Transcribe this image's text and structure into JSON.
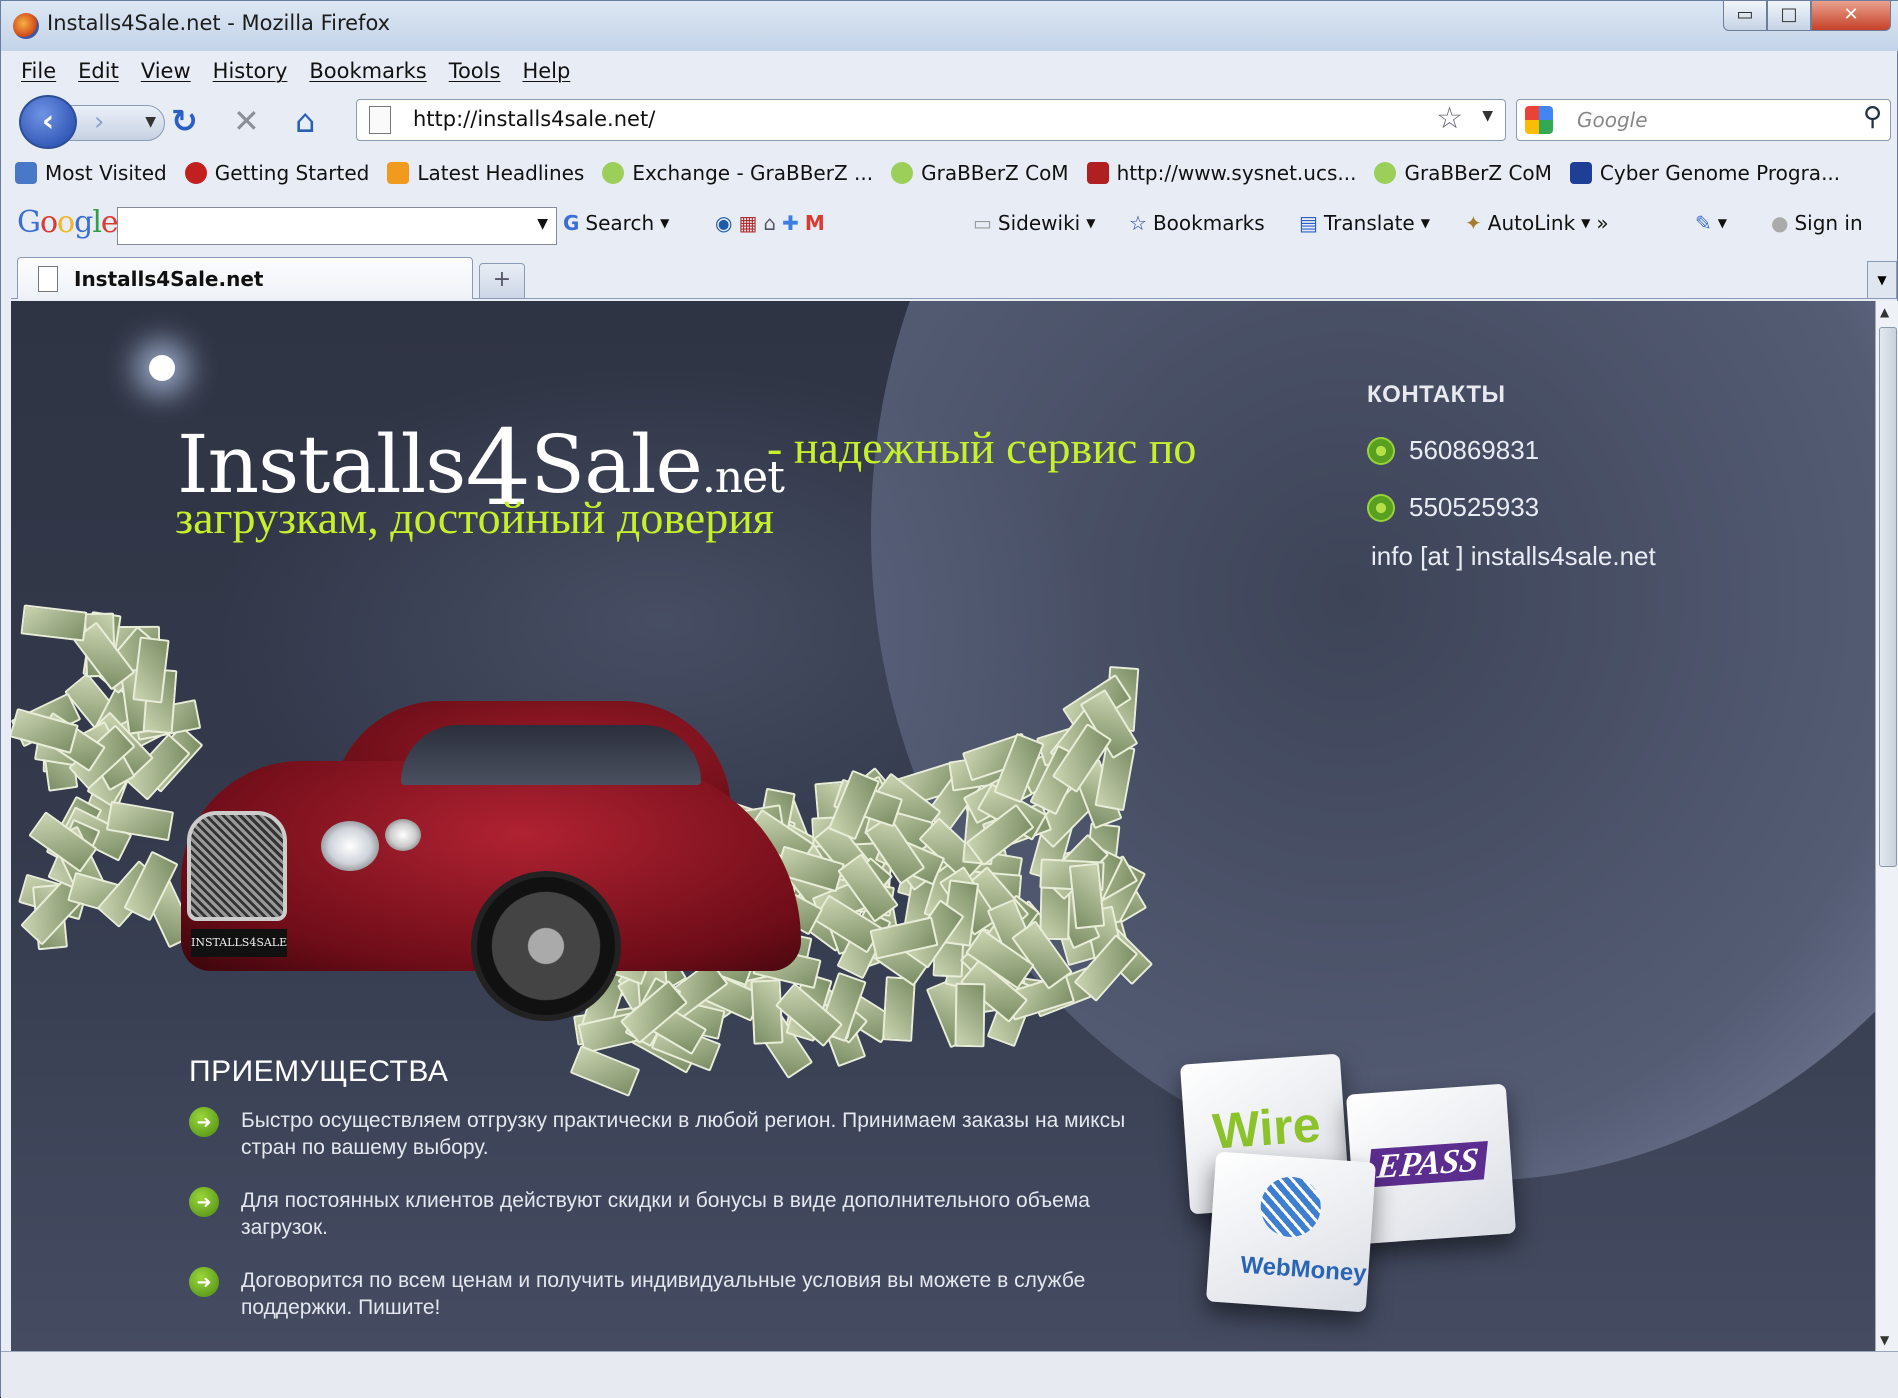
{
  "window": {
    "title": "Installs4Sale.net - Mozilla Firefox",
    "min_glyph": "▭",
    "max_glyph": "□",
    "close_glyph": "✕"
  },
  "menu": [
    "File",
    "Edit",
    "View",
    "History",
    "Bookmarks",
    "Tools",
    "Help"
  ],
  "nav": {
    "back_glyph": "‹",
    "forward_glyph": "›",
    "reload_glyph": "↻",
    "stop_glyph": "✕",
    "home_glyph": "⌂",
    "url": "http://installs4sale.net/",
    "search_placeholder": "Google"
  },
  "bookmarks": [
    {
      "label": "Most Visited",
      "icon": "most-visited-icon",
      "color": "#4a78c8"
    },
    {
      "label": "Getting Started",
      "icon": "firefox-getting-started-icon",
      "color": "#c21f1f"
    },
    {
      "label": "Latest Headlines",
      "icon": "rss-icon",
      "color": "#f29a1d"
    },
    {
      "label": "Exchange - GraBBerZ ...",
      "icon": "grabberz-icon",
      "color": "#9ccf5a"
    },
    {
      "label": "GraBBerZ CoM",
      "icon": "grabberz-icon",
      "color": "#9ccf5a"
    },
    {
      "label": "http://www.sysnet.ucs...",
      "icon": "sysnet-icon",
      "color": "#b02020"
    },
    {
      "label": "GraBBerZ CoM",
      "icon": "grabberz-icon",
      "color": "#9ccf5a"
    },
    {
      "label": "Cyber Genome Progra...",
      "icon": "star-icon",
      "color": "#1f3f96"
    }
  ],
  "google_toolbar": {
    "logo": "Google",
    "search_label": "Search",
    "sidewiki_label": "Sidewiki",
    "bookmarks_label": "Bookmarks",
    "translate_label": "Translate",
    "autolink_label": "AutoLink",
    "more_glyph": "»",
    "signin_label": "Sign in"
  },
  "tabs": [
    {
      "label": "Installs4Sale.net",
      "active": true
    }
  ],
  "new_tab_glyph": "+",
  "page": {
    "logo_main": "Installs",
    "logo_four": "4",
    "logo_sale": "Sale",
    "logo_net": ".net",
    "tagline_line1": "- надежный сервис по",
    "tagline_line2": "загрузкам, достойный доверия",
    "car_plate": "INSTALLS4SALE",
    "contacts_heading": "КОНТАКТЫ",
    "icq": [
      "560869831",
      "550525933"
    ],
    "email": "info [at ] installs4sale.net",
    "advantages_heading": "ПРИЕМУЩЕСТВА",
    "advantages": [
      "Быстро осуществляем отгрузку практически в любой регион. Принимаем заказы на миксы стран по вашему выбору.",
      "Для постоянных клиентов действуют скидки и бонусы в виде дополнительного объема загрузок.",
      "Договорится по всем ценам и получить индивидуальные условия вы можете в службе поддержки. Пишите!"
    ],
    "payment": {
      "wire": "Wire",
      "epass": "EPASS",
      "webmoney": "WebMoney"
    },
    "accent_color": "#c6f12a"
  }
}
